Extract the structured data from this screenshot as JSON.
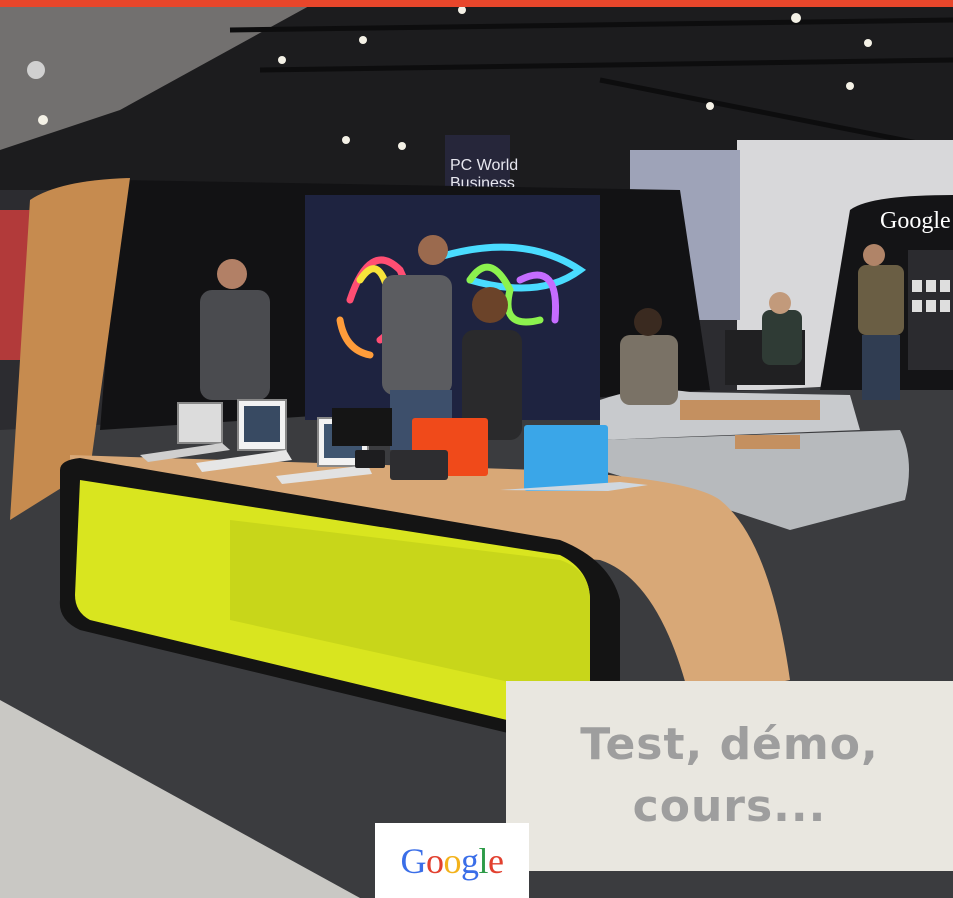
{
  "caption": {
    "line1": "Test, démo,",
    "line2": "cours..."
  },
  "logo": {
    "letters": [
      "G",
      "o",
      "o",
      "g",
      "l",
      "e"
    ],
    "colors": [
      "#3a6ee8",
      "#e2402f",
      "#f3b21b",
      "#3a6ee8",
      "#2e9b48",
      "#e2402f"
    ]
  },
  "scene_signs": {
    "store_sign": "PC World Business",
    "kiosk_brand": "Google"
  },
  "accent_color": "#e8462b"
}
